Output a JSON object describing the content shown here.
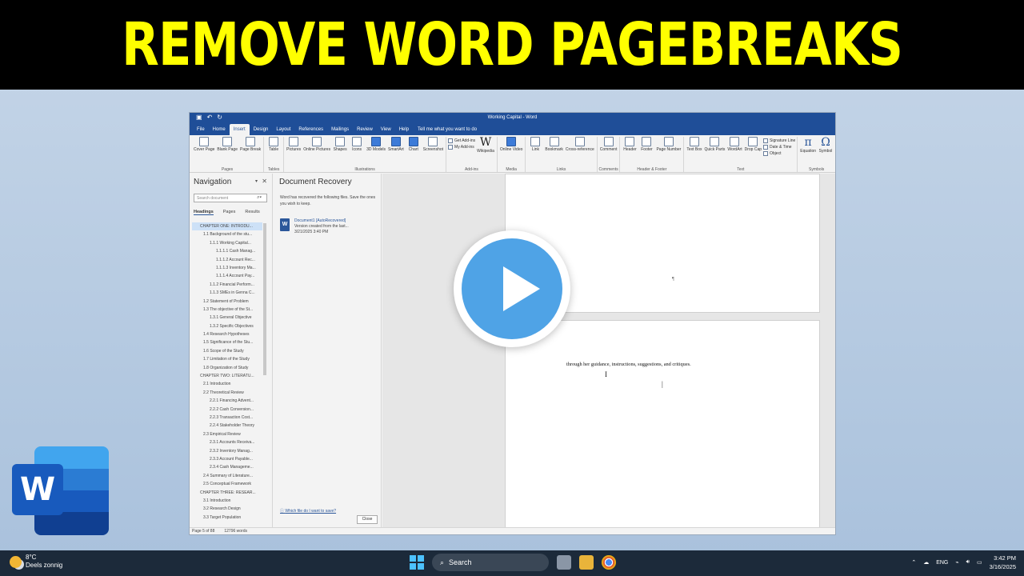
{
  "banner": {
    "title": "REMOVE WORD PAGEBREAKS"
  },
  "window": {
    "title": "Working Capital - Word",
    "tabs": [
      "File",
      "Home",
      "Insert",
      "Design",
      "Layout",
      "References",
      "Mailings",
      "Review",
      "View",
      "Help"
    ],
    "active_tab": "Insert",
    "tell_me": "Tell me what you want to do"
  },
  "ribbon": {
    "groups": [
      {
        "label": "Pages",
        "buttons": [
          "Cover Page",
          "Blank Page",
          "Page Break"
        ]
      },
      {
        "label": "Tables",
        "buttons": [
          "Table"
        ]
      },
      {
        "label": "Illustrations",
        "buttons": [
          "Pictures",
          "Online Pictures",
          "Shapes",
          "Icons",
          "3D Models",
          "SmartArt",
          "Chart",
          "Screenshot"
        ]
      },
      {
        "label": "Add-ins",
        "stack": [
          "Get Add-ins",
          "My Add-ins"
        ],
        "buttons": [
          "Wikipedia"
        ]
      },
      {
        "label": "Media",
        "buttons": [
          "Online Video"
        ]
      },
      {
        "label": "Links",
        "buttons": [
          "Link",
          "Bookmark",
          "Cross-reference"
        ]
      },
      {
        "label": "Comments",
        "buttons": [
          "Comment"
        ]
      },
      {
        "label": "Header & Footer",
        "buttons": [
          "Header",
          "Footer",
          "Page Number"
        ]
      },
      {
        "label": "Text",
        "buttons": [
          "Text Box",
          "Quick Parts",
          "WordArt",
          "Drop Cap"
        ],
        "stack": [
          "Signature Line",
          "Date & Time",
          "Object"
        ]
      },
      {
        "label": "Symbols",
        "buttons": [
          "Equation",
          "Symbol"
        ]
      }
    ]
  },
  "navigation": {
    "title": "Navigation",
    "search_placeholder": "Search document",
    "tabs": [
      "Headings",
      "Pages",
      "Results"
    ],
    "items": [
      "CHAPTER ONE: INTRODU...",
      "1.1 Background of the stu...",
      "1.1.1 Working Capital...",
      "1.1.1.1 Cash Manag...",
      "1.1.1.2 Account Rec...",
      "1.1.1.3 Inventory Ma...",
      "1.1.1.4 Account Pay...",
      "1.1.2 Financial Perform...",
      "1.1.3 SMEs in Genna C...",
      "1.2 Statement of Problem",
      "1.3 The objective of the St...",
      "1.3.1 General Objective",
      "1.3.2 Specific Objectives",
      "1.4 Research Hypotheses",
      "1.5 Significance of the Stu...",
      "1.6 Scope of the Study",
      "1.7 Limitation of the Study",
      "1.8 Organization of Study",
      "CHAPTER TWO: LITERATU...",
      "2.1 Introduction",
      "2.2 Theoretical Review",
      "2.2.1 Financing Advent...",
      "2.2.2 Cash Conversion...",
      "2.2.3 Transaction Cost...",
      "2.2.4 Stakeholder Theory",
      "2.3 Empirical Review",
      "2.3.1 Accounts Receiva...",
      "2.3.2 Inventory Manag...",
      "2.3.3 Account Payable...",
      "2.3.4 Cash Manageme...",
      "2.4 Summary of Literature...",
      "2.5 Conceptual Framework",
      "CHAPTER THREE: RESEAR...",
      "3.1 Introduction",
      "3.2 Research Design",
      "3.3 Target Population"
    ]
  },
  "recovery": {
    "title": "Document Recovery",
    "description": "Word has recovered the following files. Save the ones you wish to keep.",
    "file_name": "Document1 [AutoRecovered]",
    "file_note": "Version created from the last...",
    "file_time": "3/21/2025 3:40 PM",
    "help_link": "Which file do I want to save?",
    "close_label": "Close"
  },
  "document": {
    "page1_mark": "¶",
    "page2_text": "through her guidance, instructions, suggestions, and critiques."
  },
  "status": {
    "page": "Page 5 of 88",
    "words": "12796 words"
  },
  "taskbar": {
    "temp": "8°C",
    "condition": "Deels zonnig",
    "search": "Search",
    "lang": "ENG",
    "time": "3:42 PM",
    "date": "3/16/2025"
  },
  "colors": {
    "banner_text": "#ffff00",
    "word_blue": "#2b579a",
    "play": "#4fa3e6"
  }
}
